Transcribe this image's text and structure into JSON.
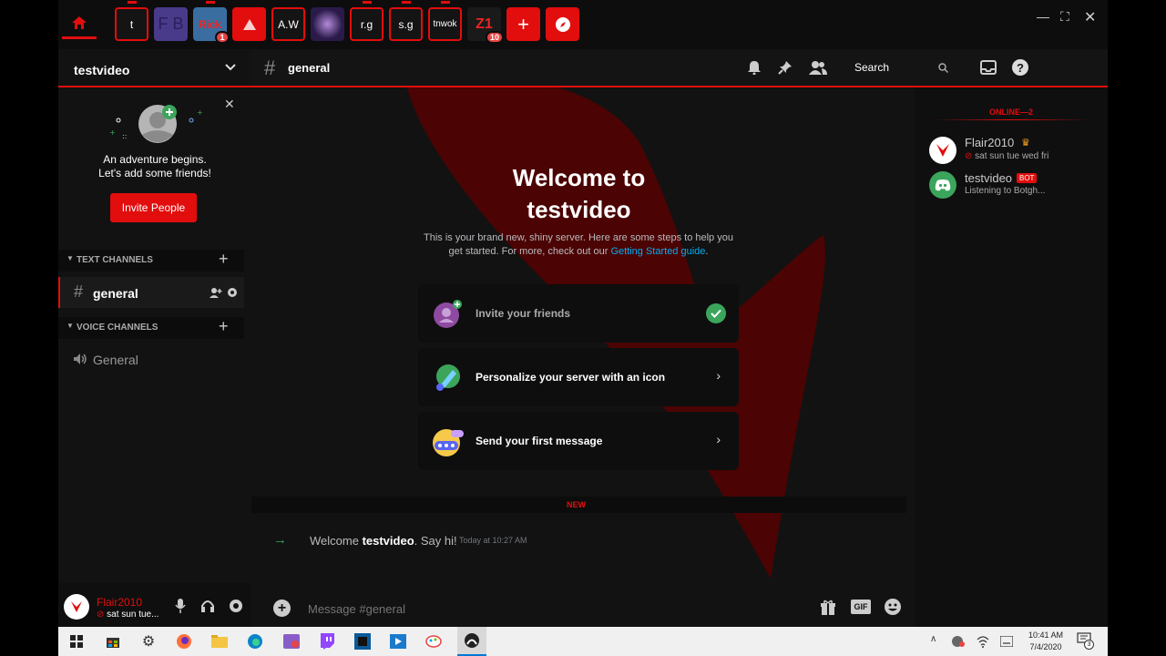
{
  "colors": {
    "accent": "#e20d0d",
    "bg": "#141414",
    "online": "#3ba55c",
    "link": "#00aff4"
  },
  "server_bar": {
    "items": [
      {
        "label": "t"
      },
      {
        "label": "F B"
      },
      {
        "label": "Rick",
        "badge": "1"
      },
      {
        "label": ""
      },
      {
        "label": "A.W"
      },
      {
        "label": ""
      },
      {
        "label": "r.g"
      },
      {
        "label": "s.g"
      },
      {
        "label": "tnwok"
      },
      {
        "label": "Z1",
        "badge": "10"
      }
    ],
    "add_icon": "plus-icon",
    "explore_icon": "compass-icon"
  },
  "guild": {
    "name": "testvideo",
    "friends_prompt": {
      "line1": "An adventure begins.",
      "line2": "Let's add some friends!",
      "button": "Invite People"
    },
    "categories": [
      {
        "name": "TEXT CHANNELS",
        "channels": [
          {
            "name": "general",
            "icon": "hash-icon"
          }
        ]
      },
      {
        "name": "VOICE CHANNELS",
        "channels": [
          {
            "name": "General",
            "icon": "speaker-icon"
          }
        ]
      }
    ]
  },
  "header": {
    "channel": "general",
    "search_placeholder": "Search"
  },
  "welcome": {
    "title_line1": "Welcome to",
    "title_line2": "testvideo",
    "body": "This is your brand new, shiny server. Here are some steps to help you get started. For more, check out our",
    "link": "Getting Started guide",
    "period": ".",
    "steps": [
      {
        "label": "Invite your friends",
        "done": true
      },
      {
        "label": "Personalize your server with an icon",
        "done": false
      },
      {
        "label": "Send your first message",
        "done": false
      }
    ]
  },
  "divider": {
    "label": "NEW"
  },
  "message": {
    "prefix": "Welcome ",
    "name": "testvideo",
    "suffix": ". Say hi!",
    "time": "Today at 10:27 AM"
  },
  "composer": {
    "placeholder": "Message #general"
  },
  "members": {
    "heading": "ONLINE—2",
    "list": [
      {
        "name": "Flair2010",
        "status": "sat sun tue wed fri",
        "crown": true,
        "bot": false
      },
      {
        "name": "testvideo",
        "status": "Listening to  Botgh...",
        "crown": false,
        "bot": true,
        "bot_tag": "BOT"
      }
    ]
  },
  "user": {
    "name": "Flair2010",
    "status": "sat sun tue..."
  },
  "taskbar": {
    "time": "10:41 AM",
    "date": "7/4/2020",
    "notif": "3"
  }
}
